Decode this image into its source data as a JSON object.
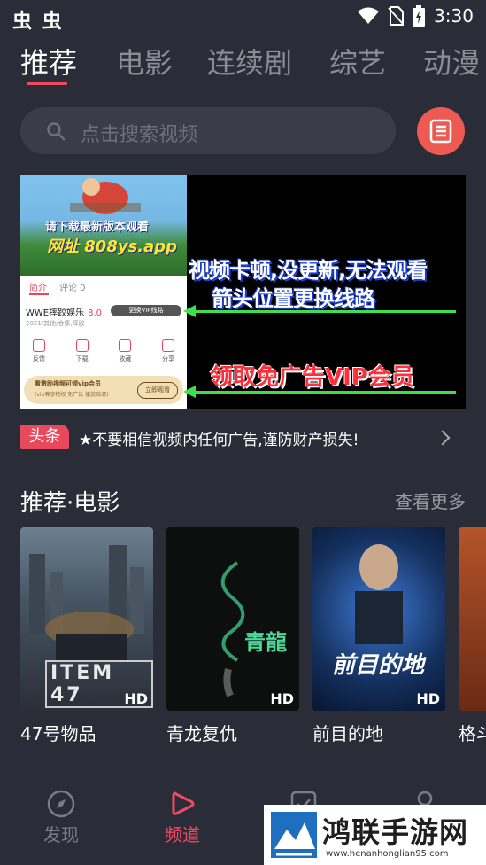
{
  "status_bar": {
    "left_icons": "虫 虫",
    "time": "3:30",
    "icons": [
      "wifi-icon",
      "no-sim-icon",
      "battery-charging-icon"
    ]
  },
  "tabs": [
    "推荐",
    "电影",
    "连续剧",
    "综艺",
    "动漫"
  ],
  "active_tab": "推荐",
  "search": {
    "placeholder": "点击搜索视频"
  },
  "banner": {
    "download_text": "请下载最新版本观看",
    "url_text": "网址 808ys.app",
    "line1": "视频卡顿,没更新,无法观看",
    "line2": "箭头位置更换线路",
    "line3": "领取免广告VIP会员",
    "mock": {
      "tab_intro": "简介",
      "tab_comments": "评论 0",
      "title": "WWE摔跤娱乐",
      "score": "8.0",
      "meta": "2021/其他/合集,摔跤",
      "switch_line": "更换VIP线路",
      "actions": [
        "反馈",
        "下载",
        "收藏",
        "分享"
      ],
      "vip_title": "看激励视频可领vip会员",
      "vip_sub": "(vip尊享特权 免广告 播放高清)",
      "vip_button": "立即观看"
    }
  },
  "notice": {
    "tag": "头条",
    "text": "★不要相信视频内任何广告,谨防财产损失!"
  },
  "section": {
    "title": "推荐·电影",
    "more": "查看更多"
  },
  "movies": [
    {
      "name": "47号物品",
      "badge": "HD",
      "poster_text": "ITEM 47"
    },
    {
      "name": "青龙复仇",
      "badge": "HD",
      "poster_text": "青龍"
    },
    {
      "name": "前目的地",
      "badge": "HD",
      "poster_text": "前目的地"
    },
    {
      "name": "格斗",
      "badge": "",
      "poster_text": ""
    }
  ],
  "bottom_nav": [
    {
      "label": "发现",
      "icon": "compass-icon",
      "active": false
    },
    {
      "label": "频道",
      "icon": "play-icon",
      "active": true
    },
    {
      "label": "",
      "icon": "checkbox-icon",
      "active": false
    },
    {
      "label": "",
      "icon": "user-icon",
      "active": false
    }
  ],
  "watermark": {
    "title": "鸿联手游网",
    "url": "www.henanhonglian95.com"
  },
  "colors": {
    "background": "#2a2d37",
    "accent": "#ef4a63",
    "search_bg": "#3a3d47",
    "list_button": "#ec5a52"
  }
}
